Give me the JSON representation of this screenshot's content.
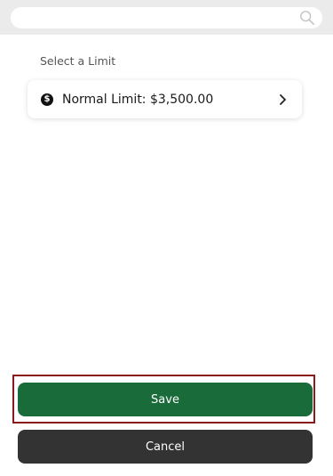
{
  "search": {
    "placeholder": "",
    "icon": "search-icon"
  },
  "section": {
    "label": "Select a Limit"
  },
  "limit_option": {
    "icon": "dollar-icon",
    "text": "Normal Limit: $3,500.00",
    "trailing_icon": "chevron-right-icon"
  },
  "actions": {
    "save_label": "Save",
    "cancel_label": "Cancel"
  },
  "colors": {
    "save_bg": "#1a6b3a",
    "cancel_bg": "#333333",
    "highlight_border": "#8b1a1a",
    "top_bar_bg": "#ebebeb"
  }
}
